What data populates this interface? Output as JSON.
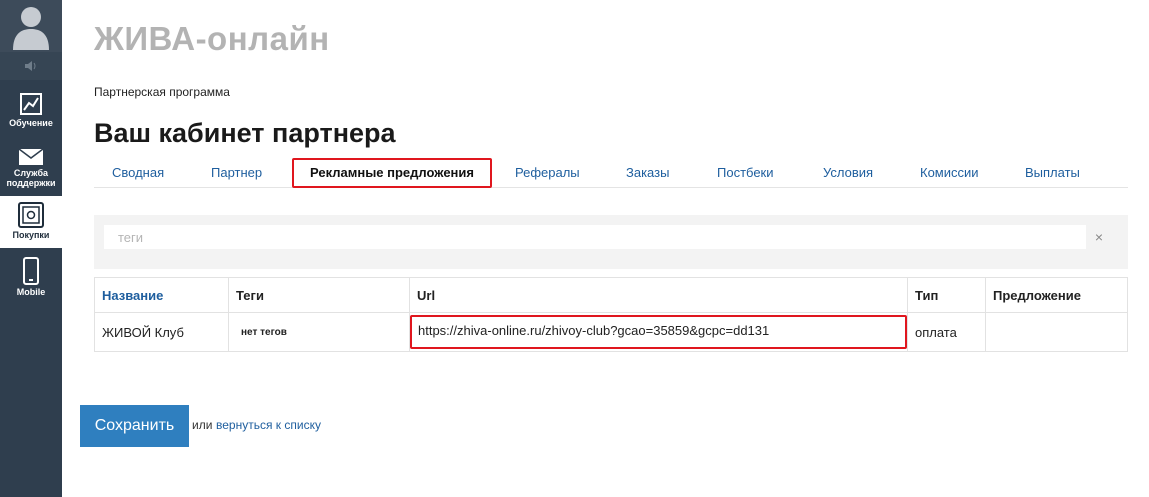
{
  "sidebar": {
    "items": [
      {
        "label": "Обучение",
        "icon": "chart-icon"
      },
      {
        "label": "Служба поддержки",
        "icon": "envelope-icon"
      },
      {
        "label": "Покупки",
        "icon": "safe-icon"
      },
      {
        "label": "Mobile",
        "icon": "phone-icon"
      }
    ],
    "active_index": 2
  },
  "header": {
    "brand": "ЖИВА-онлайн",
    "breadcrumb": "Партнерская программа",
    "title": "Ваш кабинет партнера"
  },
  "tabs": [
    {
      "label": "Сводная"
    },
    {
      "label": "Партнер"
    },
    {
      "label": "Рекламные предложения"
    },
    {
      "label": "Рефералы"
    },
    {
      "label": "Заказы"
    },
    {
      "label": "Постбеки"
    },
    {
      "label": "Условия"
    },
    {
      "label": "Комиссии"
    },
    {
      "label": "Выплаты"
    }
  ],
  "active_tab": "Рекламные предложения",
  "filter": {
    "placeholder": "теги",
    "value": "",
    "clear_label": "×"
  },
  "table": {
    "columns": [
      "Название",
      "Теги",
      "Url",
      "Тип",
      "Предложение"
    ],
    "rows": [
      {
        "name": "ЖИВОЙ Клуб",
        "tags": "нет тегов",
        "url": "https://zhiva-online.ru/zhivoy-club?gcao=35859&gcpc=dd131",
        "type": "оплата",
        "offer": ""
      }
    ]
  },
  "actions": {
    "save_label": "Сохранить",
    "or_text": "или",
    "back_label": "вернуться к списку"
  },
  "colors": {
    "sidebar_bg": "#2f3e4e",
    "link": "#1e5e9e",
    "primary_button": "#2f7fbf",
    "highlight": "#e0161e"
  }
}
